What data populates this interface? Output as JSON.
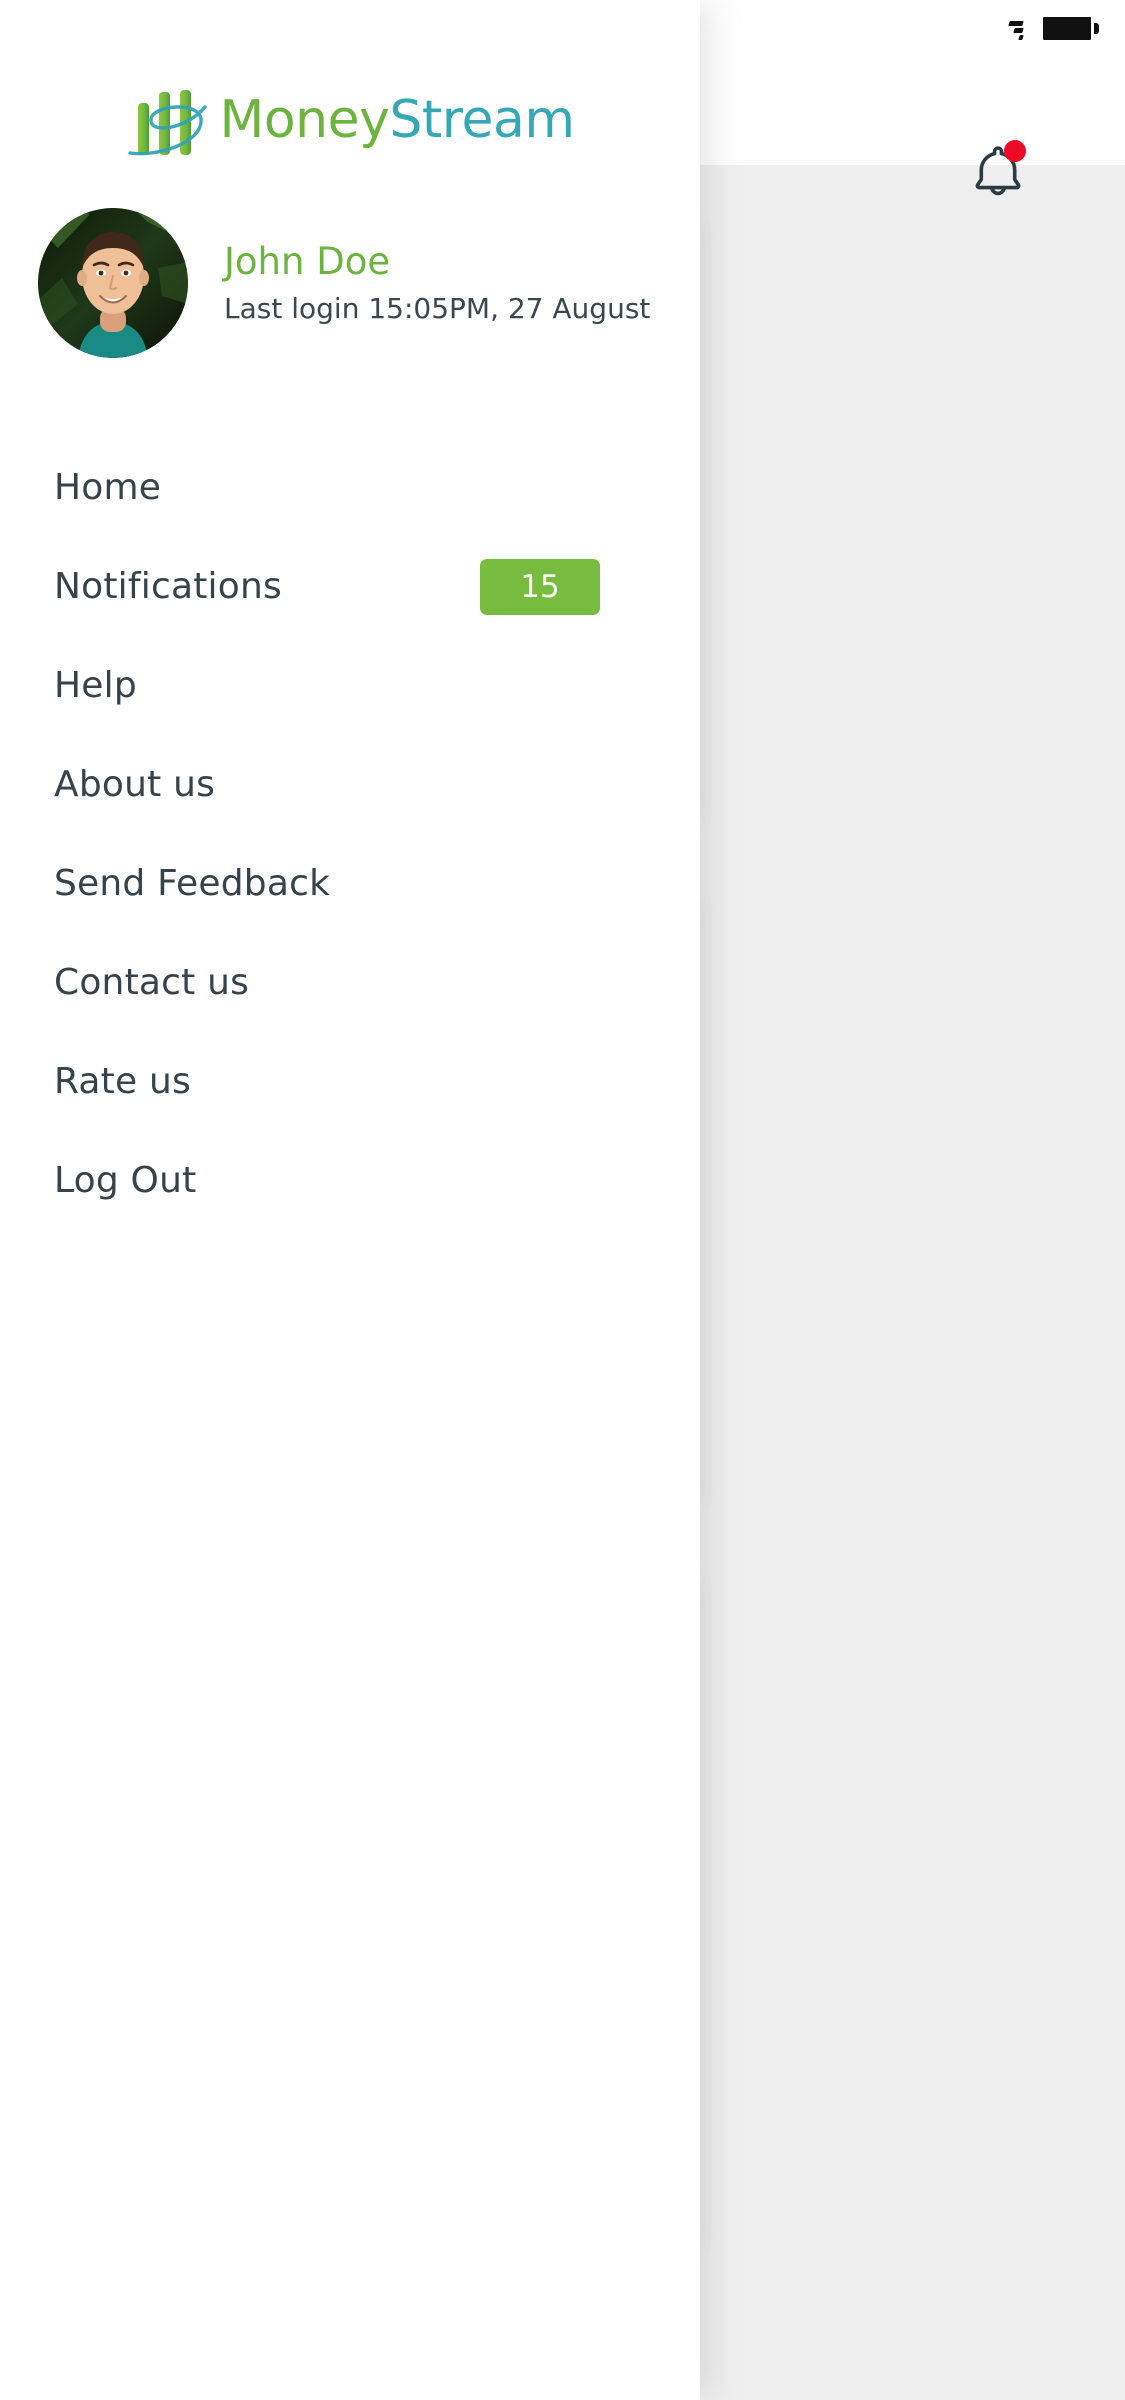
{
  "status_bar": {
    "wifi_icon": "wifi-icon",
    "battery_icon": "battery-full-icon"
  },
  "header": {
    "logo_icon": "moneystream-bars-icon",
    "brand_part_1": "Money",
    "brand_part_2": "Stream",
    "brand_color_1": "#6db33f",
    "brand_color_2": "#35a7b5",
    "bell_icon": "notification-bell-icon",
    "bell_badge_color": "#ec0b26"
  },
  "profile": {
    "avatar_icon": "user-avatar-photo",
    "name": "John Doe",
    "name_color": "#6db33f",
    "last_login": "Last login 15:05PM, 27 August"
  },
  "menu": {
    "items": [
      {
        "label": "Home",
        "badge": null
      },
      {
        "label": "Notifications",
        "badge": "15"
      },
      {
        "label": "Help",
        "badge": null
      },
      {
        "label": "About us",
        "badge": null
      },
      {
        "label": "Send Feedback",
        "badge": null
      },
      {
        "label": "Contact us",
        "badge": null
      },
      {
        "label": "Rate us",
        "badge": null
      },
      {
        "label": "Log Out",
        "badge": null
      }
    ],
    "badge_color": "#78bc3f",
    "label_color": "#36434c"
  }
}
